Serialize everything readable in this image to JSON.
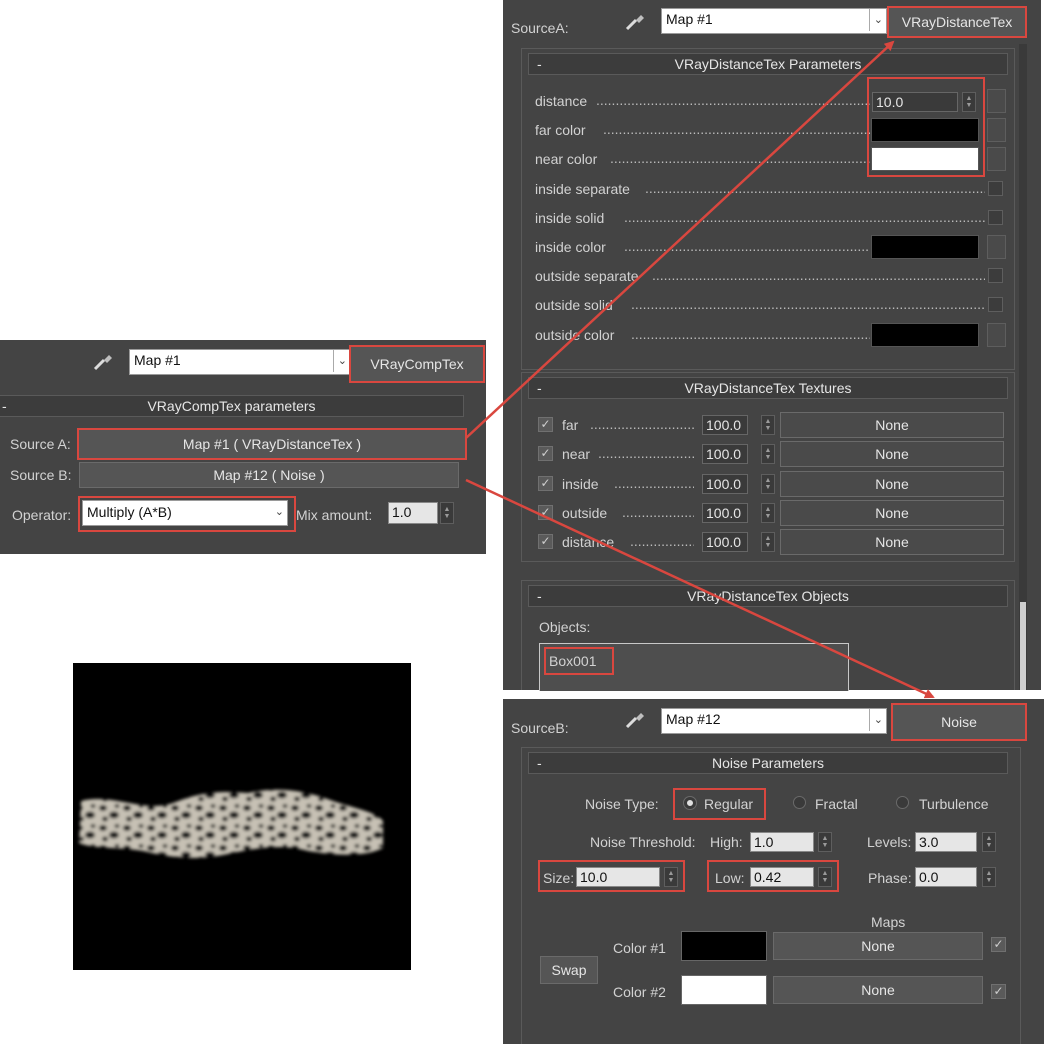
{
  "dist_panel": {
    "source_label": "SourceA:",
    "map_value": "Map #1",
    "type_button": "VRayDistanceTex",
    "params_title": "VRayDistanceTex Parameters",
    "params": [
      {
        "label": "distance",
        "kind": "spinner",
        "value": "10.0"
      },
      {
        "label": "far color",
        "kind": "color",
        "color": "#000000"
      },
      {
        "label": "near color",
        "kind": "color",
        "color": "#ffffff"
      },
      {
        "label": "inside separate",
        "kind": "checkbox"
      },
      {
        "label": "inside solid",
        "kind": "checkbox"
      },
      {
        "label": "inside color",
        "kind": "color",
        "color": "#000000"
      },
      {
        "label": "outside separate",
        "kind": "checkbox"
      },
      {
        "label": "outside solid",
        "kind": "checkbox"
      },
      {
        "label": "outside color",
        "kind": "color",
        "color": "#000000"
      }
    ],
    "textures_title": "VRayDistanceTex Textures",
    "textures": [
      {
        "label": "far",
        "value": "100.0",
        "map": "None",
        "checked": true
      },
      {
        "label": "near",
        "value": "100.0",
        "map": "None",
        "checked": true
      },
      {
        "label": "inside",
        "value": "100.0",
        "map": "None",
        "checked": true
      },
      {
        "label": "outside",
        "value": "100.0",
        "map": "None",
        "checked": true
      },
      {
        "label": "distance",
        "value": "100.0",
        "map": "None",
        "checked": true
      }
    ],
    "objects_title": "VRayDistanceTex Objects",
    "objects_label": "Objects:",
    "objects": [
      "Box001"
    ]
  },
  "comp_panel": {
    "map_value": "Map #1",
    "type_button": "VRayCompTex",
    "title": "VRayCompTex parameters",
    "source_a_label": "Source A:",
    "source_a_value": "Map #1  ( VRayDistanceTex )",
    "source_b_label": "Source B:",
    "source_b_value": "Map #12  ( Noise )",
    "operator_label": "Operator:",
    "operator_value": "Multiply (A*B)",
    "mix_label": "Mix amount:",
    "mix_value": "1.0"
  },
  "noise_panel": {
    "source_label": "SourceB:",
    "map_value": "Map #12",
    "type_button": "Noise",
    "title": "Noise Parameters",
    "noise_type_label": "Noise Type:",
    "noise_types": [
      "Regular",
      "Fractal",
      "Turbulence"
    ],
    "selected_type": "Regular",
    "threshold_label": "Noise Threshold:",
    "high_label": "High:",
    "high_value": "1.0",
    "levels_label": "Levels:",
    "levels_value": "3.0",
    "size_label": "Size:",
    "size_value": "10.0",
    "low_label": "Low:",
    "low_value": "0.42",
    "phase_label": "Phase:",
    "phase_value": "0.0",
    "maps_label": "Maps",
    "swap_label": "Swap",
    "color1_label": "Color #1",
    "color1": "#000000",
    "color1_map": "None",
    "color2_label": "Color #2",
    "color2": "#ffffff",
    "color2_map": "None"
  },
  "icons": [
    "eyedropper-icon",
    "chevron-down-icon",
    "spinner-arrows-icon",
    "checkmark-icon"
  ],
  "accent_color": "#d9473f"
}
